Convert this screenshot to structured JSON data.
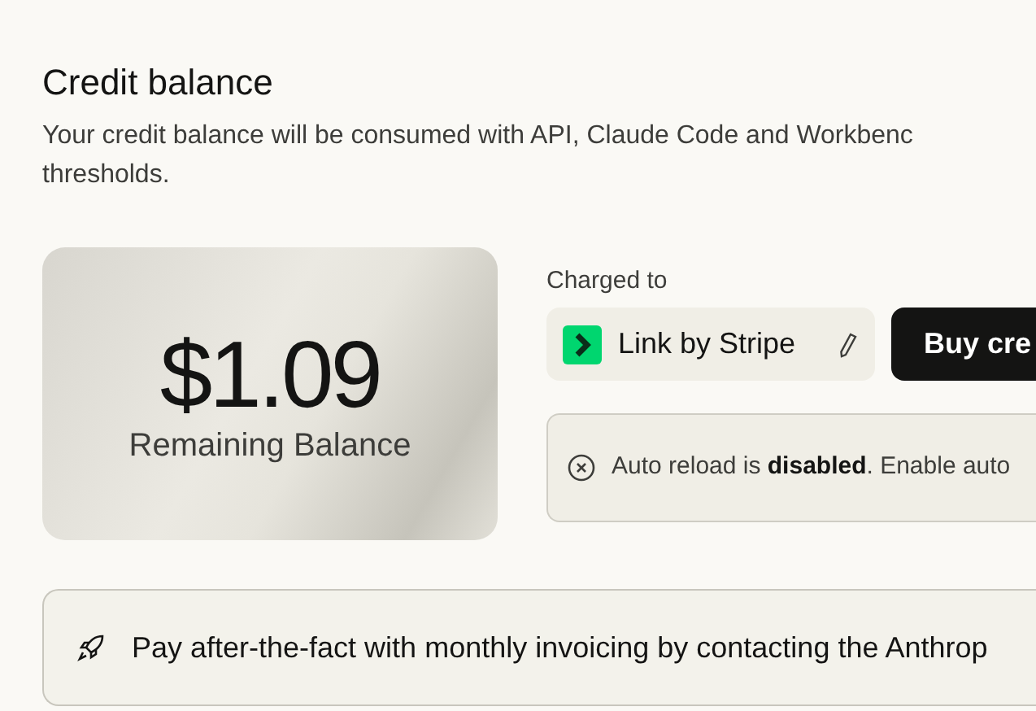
{
  "title": "Credit balance",
  "description": "Your credit balance will be consumed with API, Claude Code and Workbenc",
  "description_2": "thresholds.",
  "balance": {
    "amount": "$1.09",
    "label": "Remaining Balance"
  },
  "payment": {
    "label": "Charged to",
    "method": "Link by Stripe",
    "buy_button": "Buy cre"
  },
  "auto_reload": {
    "enabled": false,
    "text": "Auto reload is **disabled**. Enable auto"
  },
  "invoice_note": "Pay after-the-fact with monthly invoicing by contacting the Anthrop"
}
